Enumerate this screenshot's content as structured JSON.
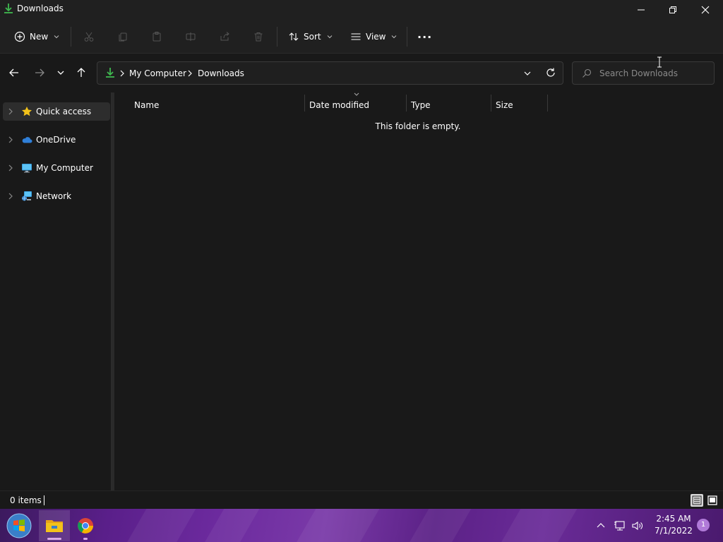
{
  "window": {
    "title": "Downloads",
    "icon": "download-arrow-icon"
  },
  "toolbar": {
    "new_label": "New",
    "sort_label": "Sort",
    "view_label": "View",
    "more_label": "···",
    "icons": [
      "cut-icon",
      "copy-icon",
      "paste-icon",
      "rename-icon",
      "share-icon",
      "delete-icon"
    ]
  },
  "address": {
    "crumbs": [
      "My Computer",
      "Downloads"
    ],
    "search_placeholder": "Search Downloads"
  },
  "nav_pane": {
    "items": [
      {
        "label": "Quick access",
        "icon": "star-icon",
        "selected": true
      },
      {
        "label": "OneDrive",
        "icon": "cloud-icon"
      },
      {
        "label": "My Computer",
        "icon": "monitor-icon"
      },
      {
        "label": "Network",
        "icon": "network-icon"
      }
    ]
  },
  "columns": {
    "name": "Name",
    "date_modified": "Date modified",
    "type": "Type",
    "size": "Size"
  },
  "content": {
    "empty_message": "This folder is empty."
  },
  "status": {
    "items_count": "0 items"
  },
  "taskbar": {
    "time": "2:45 AM",
    "date": "7/1/2022",
    "notification_count": "1"
  },
  "colors": {
    "accent_green": "#3fb950",
    "folder_yellow": "#f3c21a",
    "taskbar_purple": "#6c2a9e"
  }
}
